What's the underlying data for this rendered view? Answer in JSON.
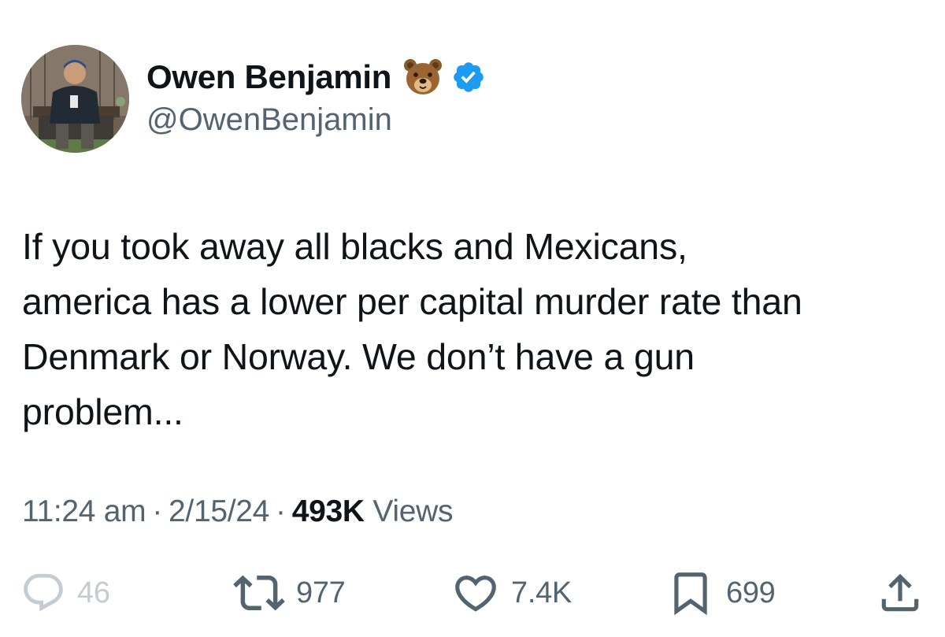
{
  "user": {
    "display_name": "Owen Benjamin",
    "handle": "@OwenBenjamin",
    "name_emoji": "bear-face-icon",
    "verified_badge": "verified-check-icon",
    "verified_color": "#1d9bf0"
  },
  "tweet": {
    "lines": [
      "If you took away all blacks and Mexicans,",
      "america has a lower per capital murder rate than",
      "Denmark or Norway. We don’t have a gun",
      "problem..."
    ]
  },
  "meta": {
    "time": "11:24 am",
    "date": "2/15/24",
    "views_count": "493K",
    "views_label": "Views",
    "separator": "·"
  },
  "actions": {
    "reply": {
      "icon": "reply-bubble-icon",
      "count": "46"
    },
    "retweet": {
      "icon": "retweet-icon",
      "count": "977"
    },
    "like": {
      "icon": "heart-icon",
      "count": "7.4K"
    },
    "bookmark": {
      "icon": "bookmark-icon",
      "count": "699"
    },
    "share": {
      "icon": "share-upload-icon"
    }
  },
  "colors": {
    "text_primary": "#0f1419",
    "text_secondary": "#536471",
    "reply_faded": "#c4ccd2"
  }
}
